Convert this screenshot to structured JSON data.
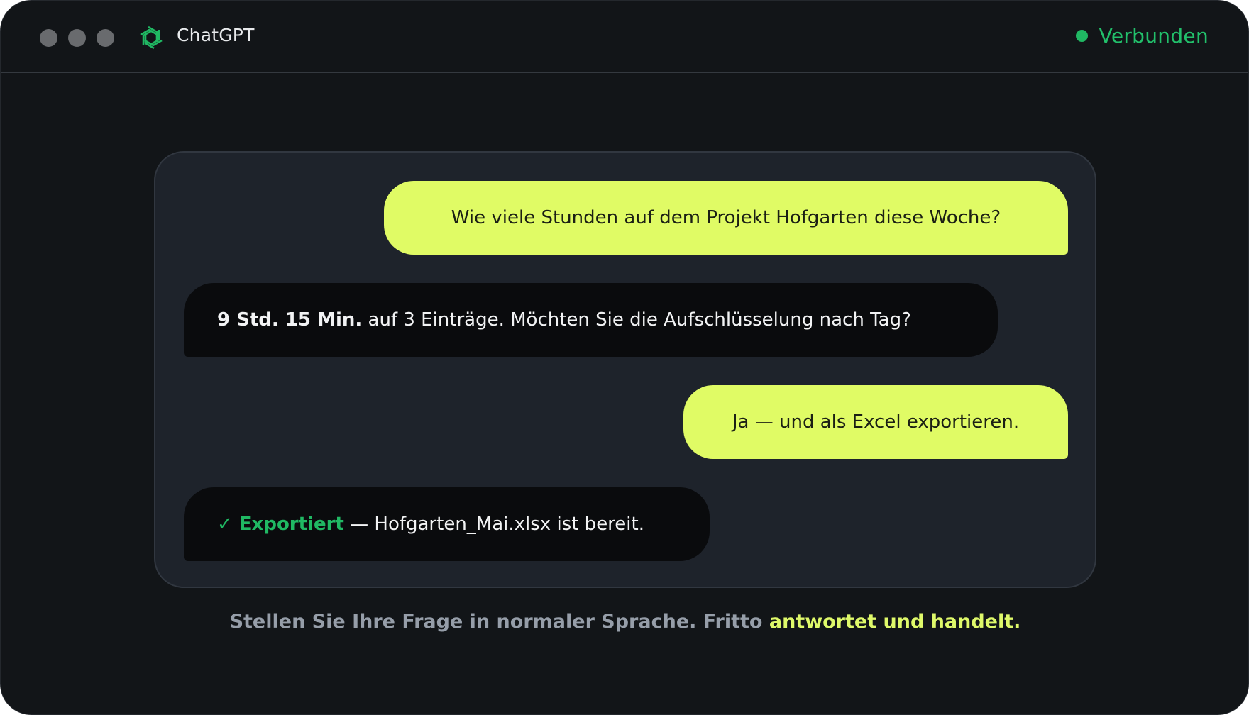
{
  "window": {
    "app_title": "ChatGPT",
    "app_icon": "openai-logo-icon",
    "status": {
      "label": "Verbunden",
      "color": "#20b863"
    }
  },
  "messages": [
    {
      "role": "user",
      "text": "Wie viele Stunden auf dem Projekt Hofgarten diese Woche?"
    },
    {
      "role": "assistant",
      "strong": "9 Std. 15 Min.",
      "text": " auf 3 Einträge. Möchten Sie die Aufschlüsselung nach Tag?"
    },
    {
      "role": "user",
      "text": "Ja — und als Excel exportieren."
    },
    {
      "role": "assistant",
      "check": "✓",
      "strong": "Exportiert",
      "text": " — Hofgarten_Mai.xlsx ist bereit."
    }
  ],
  "caption": {
    "lead": "Stellen Sie Ihre Frage in normaler Sprache. Fritto ",
    "highlight": "antwortet und handelt."
  },
  "colors": {
    "user_bubble": "#e0fb65",
    "assistant_bubble": "#0a0b0d",
    "accent_green": "#20b863",
    "highlight": "#dff96a"
  }
}
